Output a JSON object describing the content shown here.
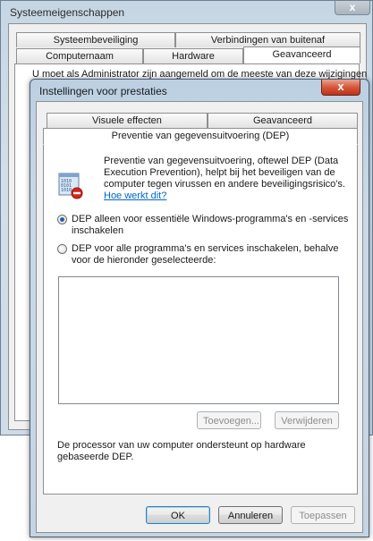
{
  "background_window": {
    "title": "Systeemeigenschappen",
    "close_glyph": "x",
    "tabs_row1": [
      "Systeembeveiliging",
      "Verbindingen van buitenaf"
    ],
    "tabs_row2": [
      "Computernaam",
      "Hardware",
      "Geavanceerd"
    ],
    "body_text": "U moet als Administrator zijn aangemeld om de meeste van deze wijzigingen"
  },
  "dialog": {
    "title": "Instellingen voor prestaties",
    "close_glyph": "x",
    "tabs_row1": [
      "Visuele effecten",
      "Geavanceerd"
    ],
    "active_tab": "Preventie van gegevensuitvoering (DEP)",
    "intro_text": "Preventie van gegevensuitvoering, oftewel DEP (Data Execution Prevention), helpt bij het beveiligen van de computer tegen virussen en andere beveiligingsrisico's.",
    "intro_link": "Hoe werkt dit?",
    "icon": "dep-shield-icon",
    "options": [
      {
        "label": "DEP alleen voor essentiële Windows-programma's en -services inschakelen",
        "checked": true
      },
      {
        "label": "DEP voor alle programma's en services inschakelen, behalve voor de hieronder geselecteerde:",
        "checked": false
      }
    ],
    "add_button": "Toevoegen...",
    "remove_button": "Verwijderen",
    "footer_note": "De processor van uw computer ondersteunt op hardware gebaseerde DEP.",
    "ok_button": "OK",
    "cancel_button": "Annuleren",
    "apply_button": "Toepassen"
  },
  "colors": {
    "link": "#0066cc",
    "close_red": "#c0311a",
    "radio_dot": "#1f5fa8"
  }
}
